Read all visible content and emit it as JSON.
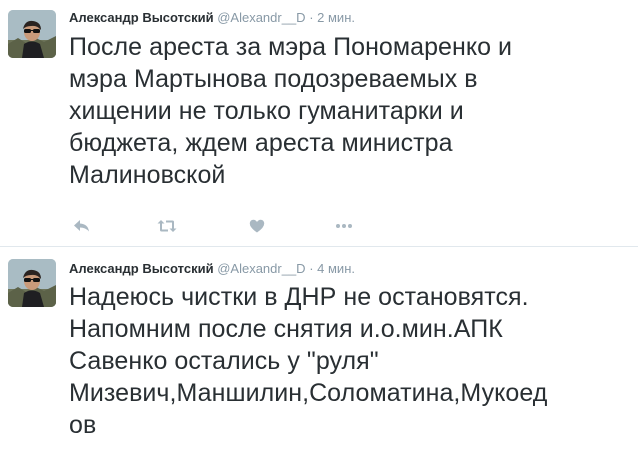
{
  "tweets": [
    {
      "fullname": "Александр Высотский",
      "username": "@Alexandr__D",
      "separator": "·",
      "time": "2 мин.",
      "lines": [
        "После ареста за мэра Пономаренко и",
        "мэра Мартынова подозреваемых в",
        "хищении не только гуманитарки и",
        "бюджета, ждем ареста министра",
        "Малиновской"
      ],
      "actions": [
        "reply-icon",
        "retweet-icon",
        "heart-icon",
        "more-icon"
      ]
    },
    {
      "fullname": "Александр Высотский",
      "username": "@Alexandr__D",
      "separator": "·",
      "time": "4 мин.",
      "lines": [
        "Надеюсь чистки в ДНР не остановятся.",
        "Напомним после снятия и.о.мин.АПК",
        "Савенко остались у \"руля\"",
        "Мизевич,Маншилин,Соломатина,Мукоед",
        "ов"
      ]
    }
  ],
  "colors": {
    "text": "#292f33",
    "muted": "#8899a6",
    "action_icon": "#aab8c2",
    "divider": "#e1e8ed"
  }
}
